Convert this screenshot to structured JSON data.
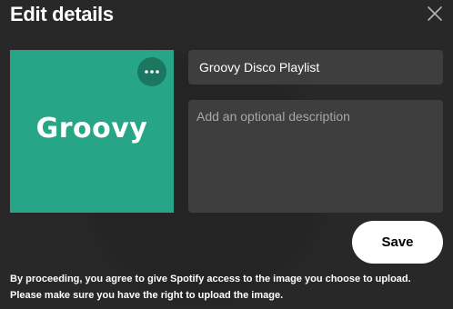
{
  "dialog": {
    "title": "Edit details",
    "close_icon": "close-icon"
  },
  "cover": {
    "text": "Groovy",
    "background_color": "#27a587",
    "more_icon": "more-options-icon"
  },
  "form": {
    "name_value": "Groovy Disco Playlist",
    "description_value": "",
    "description_placeholder": "Add an optional description"
  },
  "actions": {
    "save_label": "Save"
  },
  "disclaimer": "By proceeding, you agree to give Spotify access to the image you choose to upload. Please make sure you have the right to upload the image."
}
